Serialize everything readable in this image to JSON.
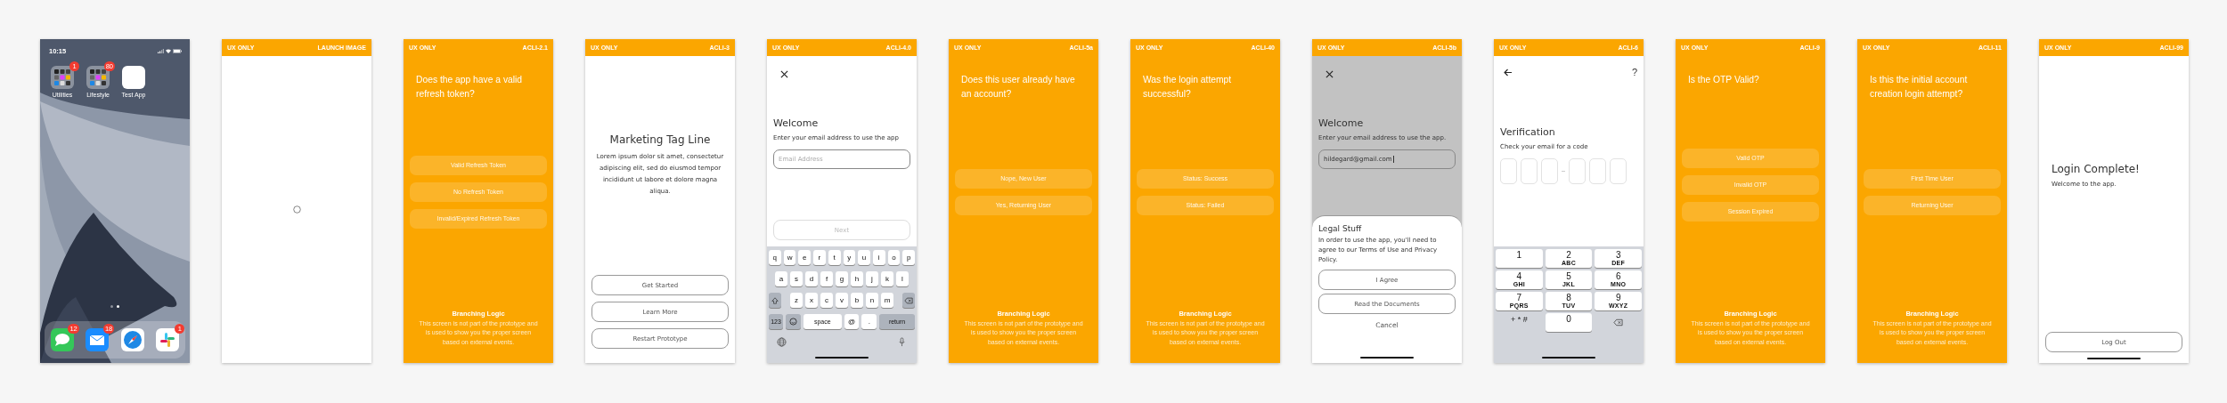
{
  "screens": [
    {
      "kind": "home",
      "status_time": "10:15",
      "apps": [
        {
          "kind": "folder",
          "label": "Utilities",
          "badge": "1"
        },
        {
          "kind": "folder",
          "label": "Lifestyle",
          "badge": "80"
        },
        {
          "kind": "app",
          "label": "Test App"
        }
      ],
      "page_dots": [
        {
          "selected": false
        },
        {
          "selected": true
        }
      ],
      "dock": [
        {
          "kind": "chat",
          "badge": "12"
        },
        {
          "kind": "mail",
          "badge": "18"
        },
        {
          "kind": "compass"
        },
        {
          "kind": "pinwheel",
          "badge": "1"
        }
      ]
    },
    {
      "kind": "loading",
      "header": {
        "left": "UX ONLY",
        "right": "LAUNCH IMAGE"
      }
    },
    {
      "kind": "question",
      "header": {
        "left": "UX ONLY",
        "right": "ACLI-2.1"
      },
      "question": "Does the app have a valid refresh token?",
      "options": [
        "Valid Refresh Token",
        "No Refresh Token",
        "Invalid/Expired Refresh Token"
      ],
      "footer_title": "Branching Logic",
      "footer_text": "This screen is not part of the prototype and is used to show you the proper screen based on external events."
    },
    {
      "kind": "marketing",
      "header": {
        "left": "UX ONLY",
        "right": "ACLI-3"
      },
      "title": "Marketing Tag Line",
      "body": "Lorem ipsum dolor sit amet, consectetur adipiscing elit, sed do eiusmod tempor incididunt ut labore et dolore magna aliqua.",
      "buttons": [
        "Get Started",
        "Learn More",
        "Restart Prototype"
      ]
    },
    {
      "kind": "email",
      "header": {
        "left": "UX ONLY",
        "right": "ACLI-4.0"
      },
      "title": "Welcome",
      "body": "Enter your email address to use the app",
      "field": {
        "placeholder": "Email Address"
      },
      "next": {
        "label": "Next",
        "disabled": true
      },
      "keyboard": {
        "rows": [
          [
            "q",
            "w",
            "e",
            "r",
            "t",
            "y",
            "u",
            "i",
            "o",
            "p"
          ],
          [
            "a",
            "s",
            "d",
            "f",
            "g",
            "h",
            "j",
            "k",
            "l"
          ],
          [
            "z",
            "x",
            "c",
            "v",
            "b",
            "n",
            "m"
          ]
        ],
        "bottom": [
          {
            "kind": "mode",
            "label": "123"
          },
          {
            "kind": "emoji"
          },
          {
            "kind": "space",
            "label": "space"
          },
          {
            "kind": "key",
            "label": "@"
          },
          {
            "kind": "key",
            "label": "."
          },
          {
            "kind": "return",
            "label": "return"
          }
        ]
      }
    },
    {
      "kind": "question",
      "header": {
        "left": "UX ONLY",
        "right": "ACLI-5a"
      },
      "question": "Does this user already have an account?",
      "options": [
        "Nope, New User",
        "Yes, Returning User"
      ],
      "footer_title": "Branching Logic",
      "footer_text": "This screen is not part of the prototype and is used to show you the proper screen based on external events."
    },
    {
      "kind": "question",
      "header": {
        "left": "UX ONLY",
        "right": "ACLI-40"
      },
      "question": "Was the login attempt successful?",
      "options": [
        "Status: Success",
        "Status: Failed"
      ],
      "footer_title": "Branching Logic",
      "footer_text": "This screen is not part of the prototype and is used to show you the proper screen based on external events."
    },
    {
      "kind": "legal",
      "header": {
        "left": "UX ONLY",
        "right": "ACLI-5b"
      },
      "title": "Welcome",
      "body": "Enter your email address to use the app.",
      "field": {
        "value": "hildegard@gmail.com"
      },
      "sheet": {
        "title": "Legal Stuff",
        "body": "In order to use the app, you'll need to agree to our Terms of Use and Privacy Policy.",
        "buttons": [
          "I Agree",
          "Read the Documents"
        ],
        "cancel": "Cancel"
      }
    },
    {
      "kind": "verification",
      "header": {
        "left": "UX ONLY",
        "right": "ACLI-6"
      },
      "help": "?",
      "title": "Verification",
      "body": "Check your email for a code",
      "keypad": [
        {
          "kind": "key",
          "digit": "1"
        },
        {
          "kind": "key",
          "digit": "2",
          "letters": "ABC"
        },
        {
          "kind": "key",
          "digit": "3",
          "letters": "DEF"
        },
        {
          "kind": "key",
          "digit": "4",
          "letters": "GHI"
        },
        {
          "kind": "key",
          "digit": "5",
          "letters": "JKL"
        },
        {
          "kind": "key",
          "digit": "6",
          "letters": "MNO"
        },
        {
          "kind": "key",
          "digit": "7",
          "letters": "PQRS"
        },
        {
          "kind": "key",
          "digit": "8",
          "letters": "TUV"
        },
        {
          "kind": "key",
          "digit": "9",
          "letters": "WXYZ"
        },
        {
          "kind": "symbols",
          "label": "+ * #"
        },
        {
          "kind": "key",
          "digit": "0"
        },
        {
          "kind": "delete"
        }
      ]
    },
    {
      "kind": "question",
      "header": {
        "left": "UX ONLY",
        "right": "ACLI-9"
      },
      "question": "Is the OTP Valid?",
      "options": [
        "Valid OTP",
        "Invalid OTP",
        "Session Expired"
      ],
      "footer_title": "Branching Logic",
      "footer_text": "This screen is not part of the prototype and is used to show you the proper screen based on external events."
    },
    {
      "kind": "question",
      "header": {
        "left": "UX ONLY",
        "right": "ACLI-11"
      },
      "question": "Is this the initial account creation login attempt?",
      "options": [
        "First Time User",
        "Returning User"
      ],
      "footer_title": "Branching Logic",
      "footer_text": "This screen is not part of the prototype and is used to show you the proper screen based on external events."
    },
    {
      "kind": "complete",
      "header": {
        "left": "UX ONLY",
        "right": "ACLI-99"
      },
      "title": "Login Complete!",
      "body": "Welcome to the app.",
      "buttons": [
        "Log Out"
      ]
    }
  ]
}
